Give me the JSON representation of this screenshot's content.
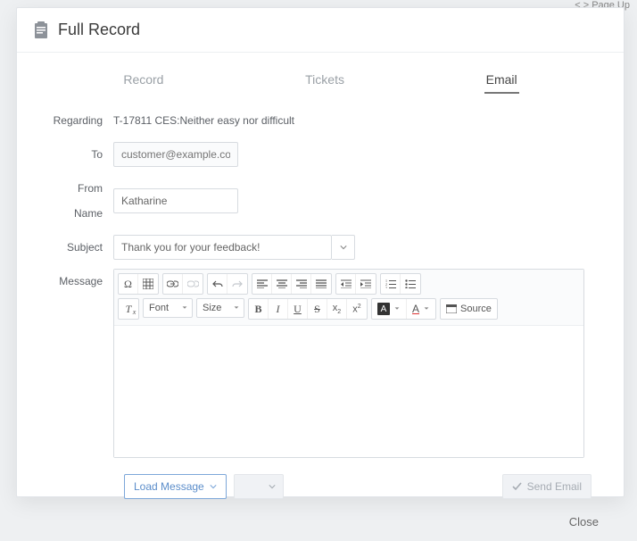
{
  "backdrop": {
    "shortcut_hint": "Page Up"
  },
  "header": {
    "title": "Full Record"
  },
  "tabs": {
    "record": "Record",
    "tickets": "Tickets",
    "email": "Email"
  },
  "labels": {
    "regarding": "Regarding",
    "to": "To",
    "from_name": "From Name",
    "subject": "Subject",
    "message": "Message"
  },
  "fields": {
    "regarding_value": "T-17811 CES:Neither easy nor difficult",
    "to_placeholder": "customer@example.com",
    "from_name_value": "Katharine",
    "subject_value": "Thank you for your feedback!"
  },
  "editor": {
    "font_label": "Font",
    "size_label": "Size",
    "source_label": "Source"
  },
  "actions": {
    "load_message": "Load Message",
    "send_email": "Send Email",
    "close": "Close"
  }
}
